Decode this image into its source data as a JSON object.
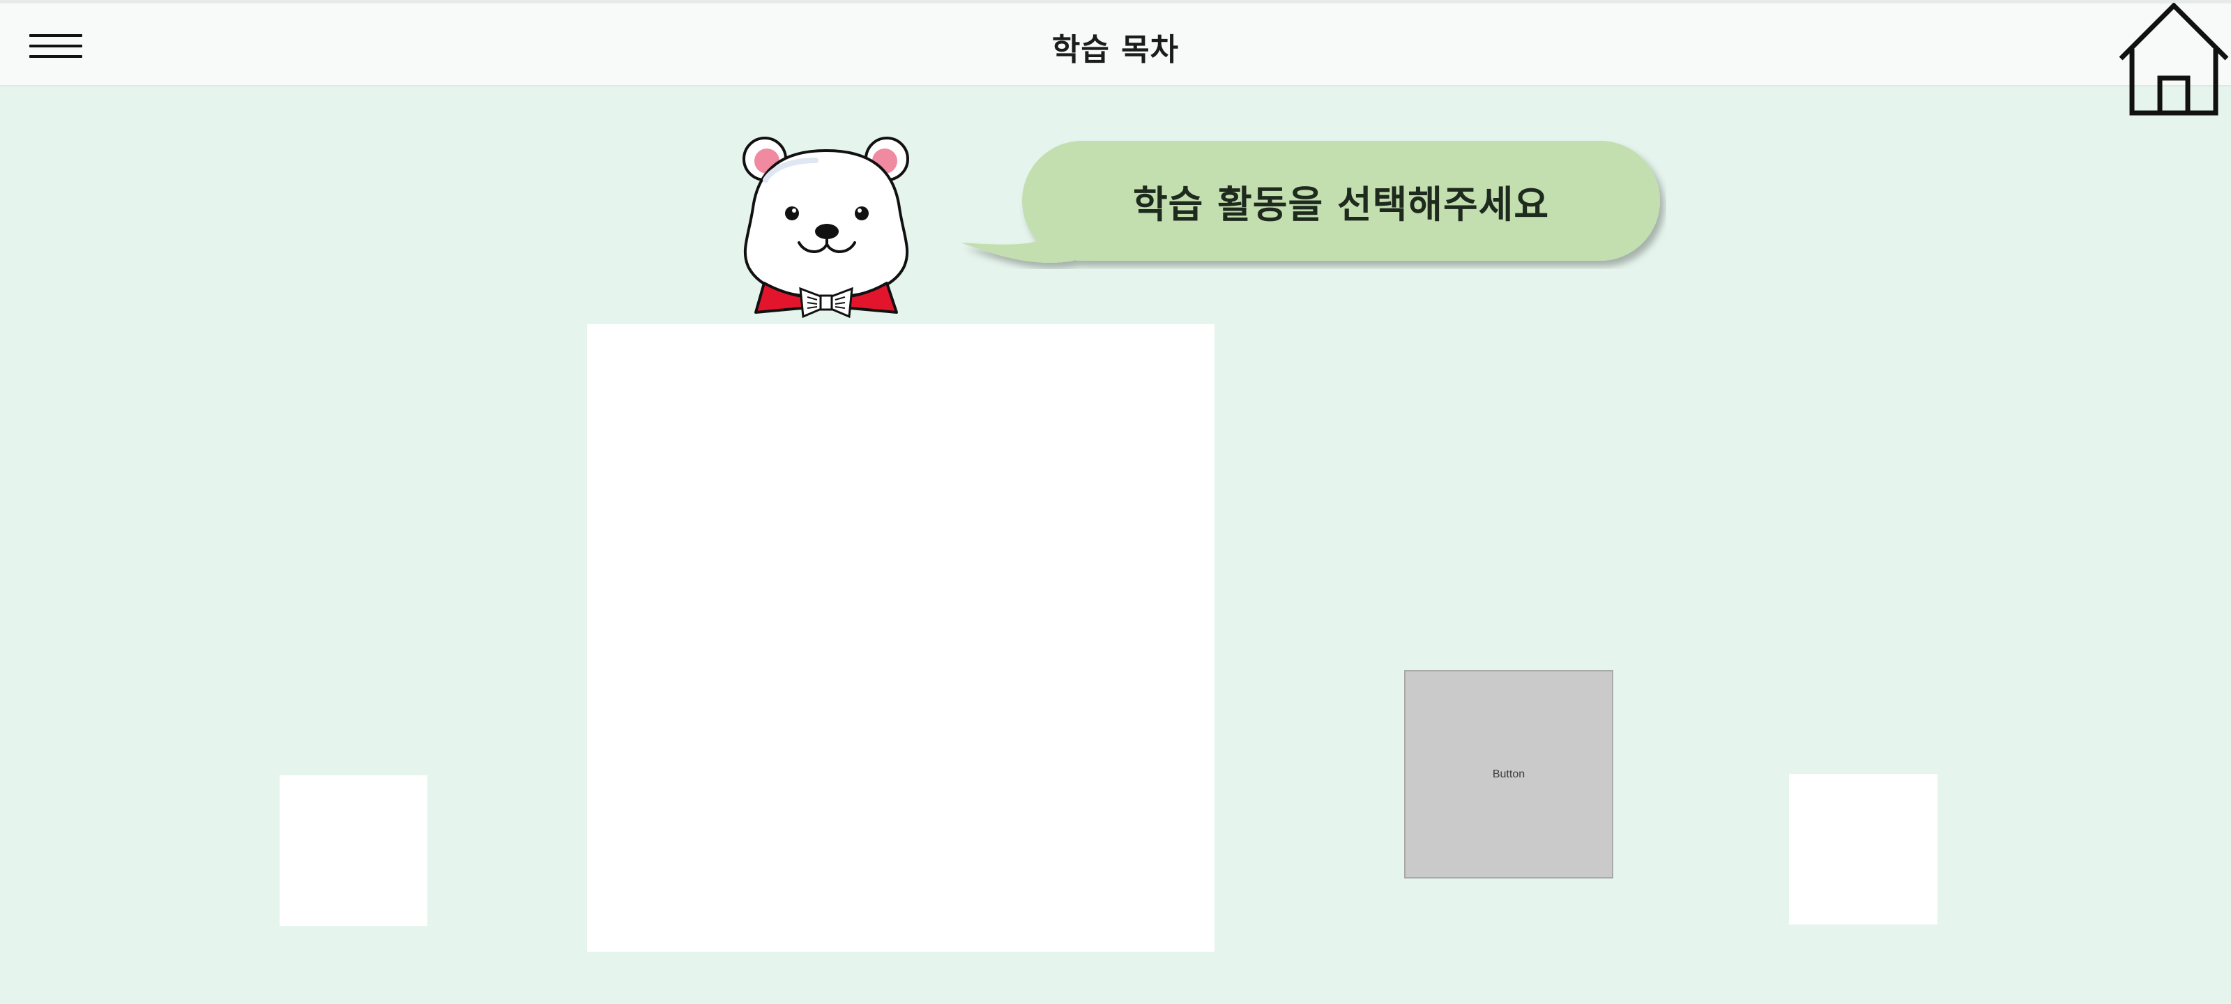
{
  "header": {
    "title": "학습 목차",
    "menu_icon": "hamburger-menu-icon",
    "home_icon": "home-icon"
  },
  "mascot": {
    "icon": "polar-bear-mascot",
    "speech": "학습 활동을 선택해주세요"
  },
  "content": {
    "button_label": "Button"
  },
  "colors": {
    "background": "#e5f4ec",
    "header": "#f8fafa",
    "speech_bubble": "#c3deaf",
    "bowtie": "#e3152c",
    "button": "#cacaca"
  }
}
